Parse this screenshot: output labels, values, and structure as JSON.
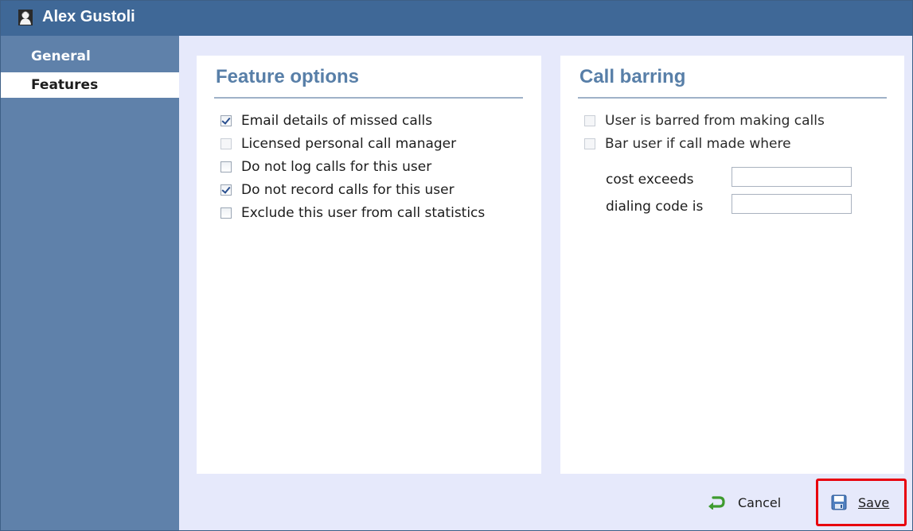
{
  "window": {
    "title": "Alex Gustoli",
    "icon": "user-silhouette-icon"
  },
  "sidebar": {
    "items": [
      {
        "label": "General",
        "selected": false
      },
      {
        "label": "Features",
        "selected": true
      }
    ]
  },
  "feature_options": {
    "title": "Feature options",
    "options": [
      {
        "label": "Email details of missed calls",
        "checked": true
      },
      {
        "label": "Licensed personal call manager",
        "checked": false,
        "disabled": true
      },
      {
        "label": "Do not log calls for this user",
        "checked": false
      },
      {
        "label": "Do not record calls for this user",
        "checked": true
      },
      {
        "label": "Exclude this user from call statistics",
        "checked": false
      }
    ]
  },
  "call_barring": {
    "title": "Call barring",
    "options": [
      {
        "label": "User is barred from making calls",
        "checked": false,
        "disabled": true
      },
      {
        "label": "Bar user if call made where",
        "checked": false,
        "disabled": true
      }
    ],
    "fields": [
      {
        "label": "cost exceeds",
        "value": ""
      },
      {
        "label": "dialing code is",
        "value": ""
      }
    ]
  },
  "actions": {
    "cancel_label": "Cancel",
    "save_label": "Save"
  },
  "colors": {
    "titlebar": "#3f6897",
    "sidebar": "#5f81aa",
    "content_bg": "#e6e9fb",
    "panel_title": "#587fa8",
    "highlight": "#e8000d"
  }
}
